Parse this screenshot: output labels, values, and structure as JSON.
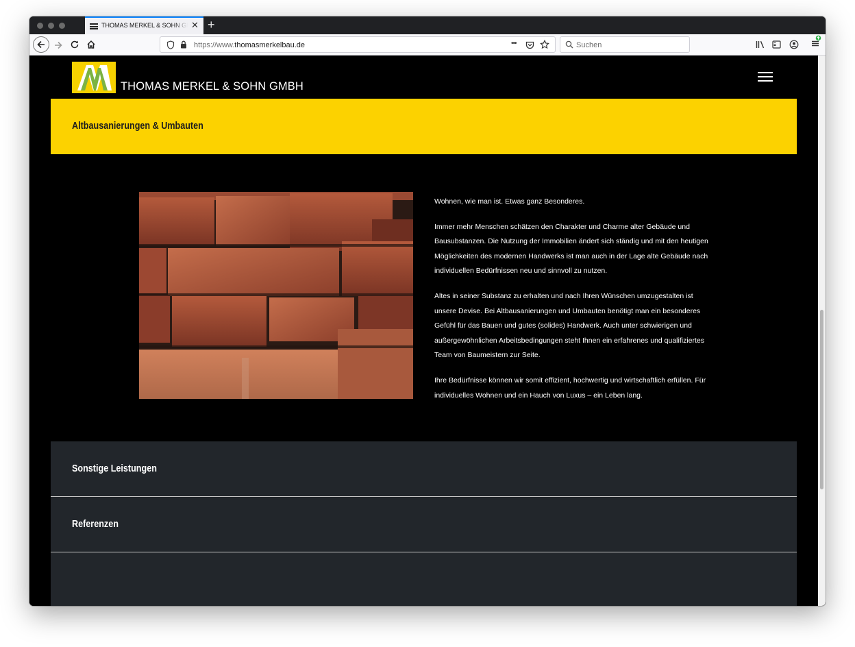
{
  "browser": {
    "tab_title": "THOMAS MERKEL & SOHN GMBH",
    "tab_close": "✕",
    "new_tab": "+",
    "url_prefix": "https://www.",
    "url_domain": "thomasmerkelbau.de",
    "search_placeholder": "Suchen",
    "page_actions": "•••",
    "icons": [
      "back-arrow-icon",
      "forward-arrow-icon",
      "reload-icon",
      "home-icon",
      "shield-icon",
      "lock-icon",
      "pocket-icon",
      "bookmark-star-icon",
      "search-icon",
      "library-icon",
      "sidebar-icon",
      "account-icon",
      "menu-icon"
    ]
  },
  "site": {
    "company_name": "THOMAS MERKEL & SOHN GMBH",
    "colors": {
      "brand_yellow": "#fcd200",
      "band_dark": "#22262b",
      "logo_green": "#7cb342"
    }
  },
  "sections": {
    "active": {
      "title": "Altbausanierungen & Umbauten",
      "paragraphs": [
        "Wohnen, wie man ist. Etwas ganz Besonderes.",
        "Immer mehr Menschen schätzen den Charakter und Charme alter Gebäude und Bausubstanzen. Die Nutzung der Immobilien ändert sich ständig und mit den heutigen Möglichkeiten des modernen Handwerks ist man auch in der Lage alte Gebäude nach individuellen Bedürfnissen neu und sinnvoll zu nutzen.",
        "Altes in seiner Substanz zu erhalten und nach Ihren Wünschen umzugestalten ist unsere Devise. Bei Altbausanierungen und Umbauten benötigt man ein besonderes Gefühl für das Bauen und gutes (solides) Handwerk. Auch unter schwierigen und außergewöhnlichen Arbeitsbedingungen steht Ihnen ein erfahrenes und qualifiziertes Team von Baumeistern zur Seite.",
        "Ihre Bedürfnisse können wir somit effizient, hochwertig und wirtschaftlich erfüllen. Für individuelles Wohnen und ein Hauch von Luxus – ein Leben lang."
      ]
    },
    "collapsed": [
      {
        "label": "Sonstige Leistungen"
      },
      {
        "label": "Referenzen"
      }
    ]
  }
}
